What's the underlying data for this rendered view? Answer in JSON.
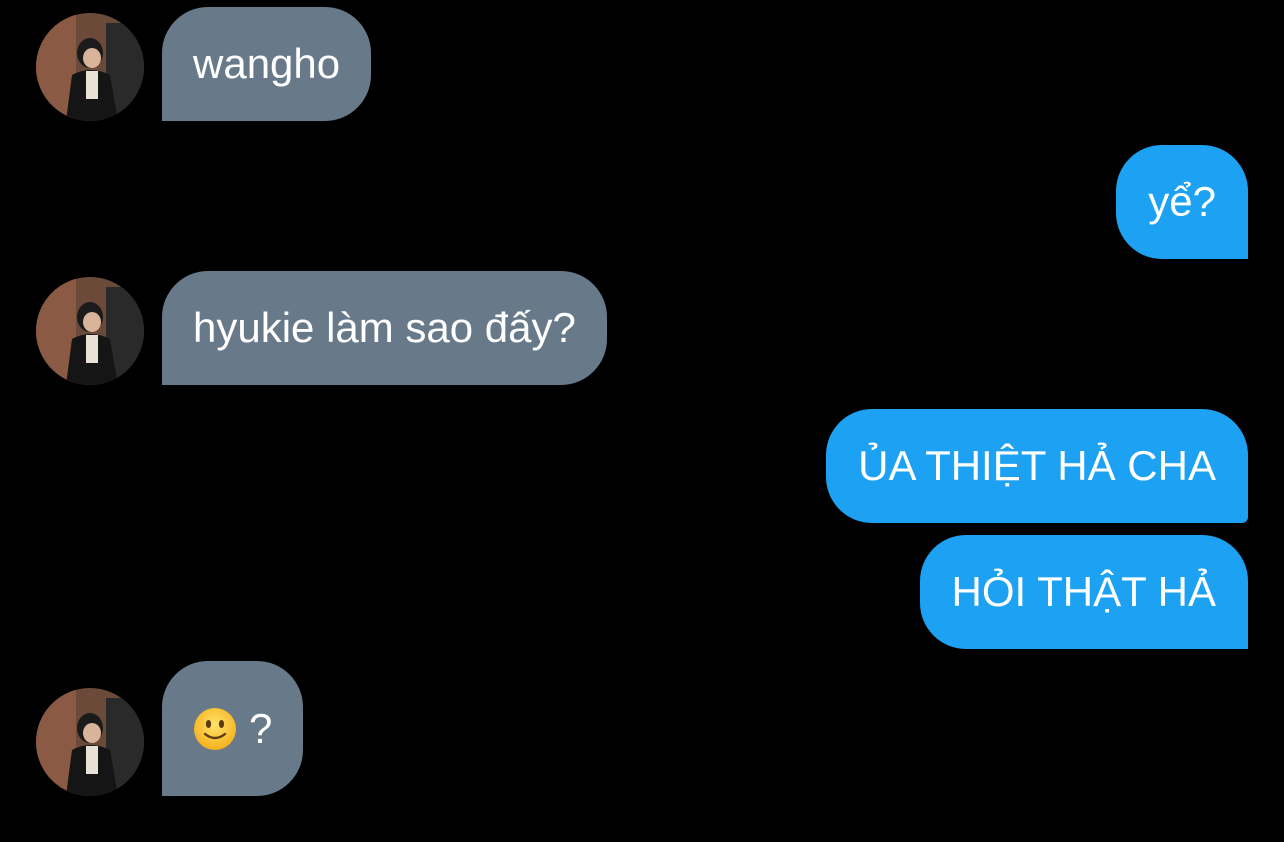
{
  "conversation": {
    "messages": [
      {
        "from": "incoming",
        "text": "wangho"
      },
      {
        "from": "outgoing",
        "text": "yể?"
      },
      {
        "from": "incoming",
        "text": "hyukie làm sao đấy?"
      },
      {
        "from": "outgoing",
        "text": "ỦA THIỆT HẢ CHA"
      },
      {
        "from": "outgoing",
        "text": "HỎI THẬT HẢ"
      },
      {
        "from": "incoming",
        "emoji": "slightly-smiling-face-icon",
        "text": "?"
      }
    ]
  },
  "colors": {
    "background": "#000000",
    "incoming_bubble": "#687a89",
    "outgoing_bubble": "#1da1f2",
    "text": "#ffffff"
  }
}
